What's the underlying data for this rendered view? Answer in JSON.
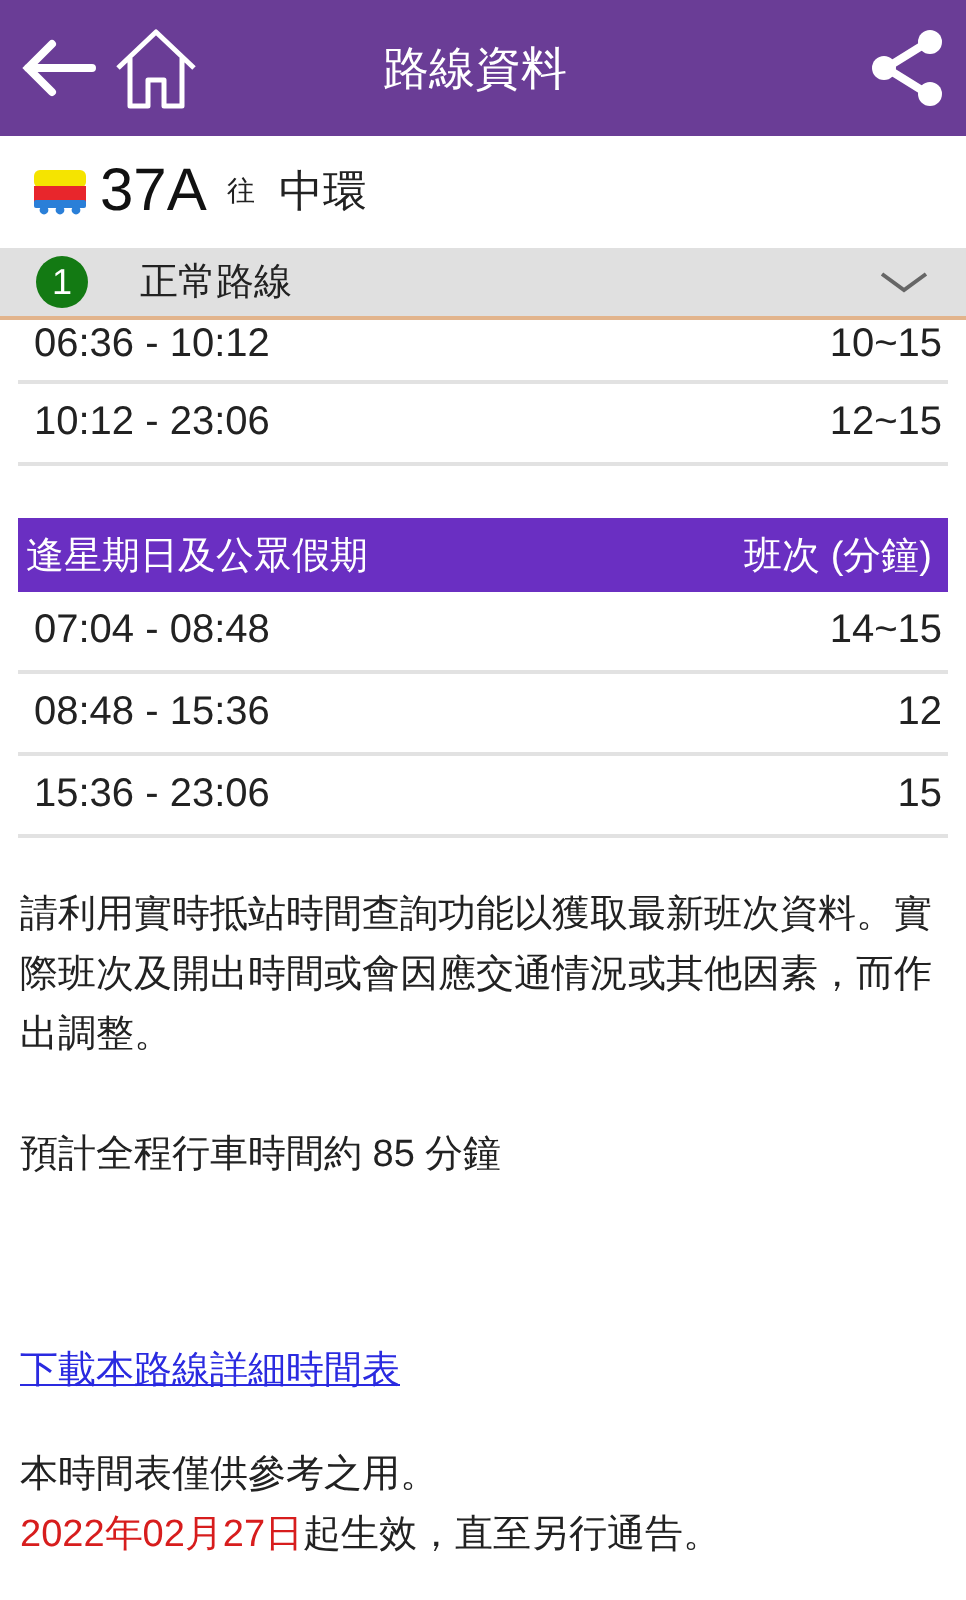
{
  "app_bar": {
    "title": "路線資料"
  },
  "route": {
    "number": "37A",
    "direction_label": "往",
    "destination": "中環"
  },
  "variant": {
    "badge": "1",
    "name": "正常路線",
    "expanded": false
  },
  "schedules": [
    {
      "rows": [
        {
          "time": "06:36 - 10:12",
          "frequency": "10~15"
        },
        {
          "time": "10:12 - 23:06",
          "frequency": "12~15"
        }
      ]
    },
    {
      "heading": "逢星期日及公眾假期",
      "frequency_heading": "班次 (分鐘)",
      "rows": [
        {
          "time": "07:04 - 08:48",
          "frequency": "14~15"
        },
        {
          "time": "08:48 - 15:36",
          "frequency": "12"
        },
        {
          "time": "15:36 - 23:06",
          "frequency": "15"
        }
      ]
    }
  ],
  "notice": "請利用實時抵站時間查詢功能以獲取最新班次資料。實際班次及開出時間或會因應交通情況或其他因素，而作出調整。",
  "journey_time": "預計全程行車時間約 85 分鐘",
  "download_link": "下載本路線詳細時間表",
  "disclaimer": "本時間表僅供參考之用。",
  "effective": {
    "date": "2022年02月27日",
    "text": "起生效，直至另行通告。"
  }
}
